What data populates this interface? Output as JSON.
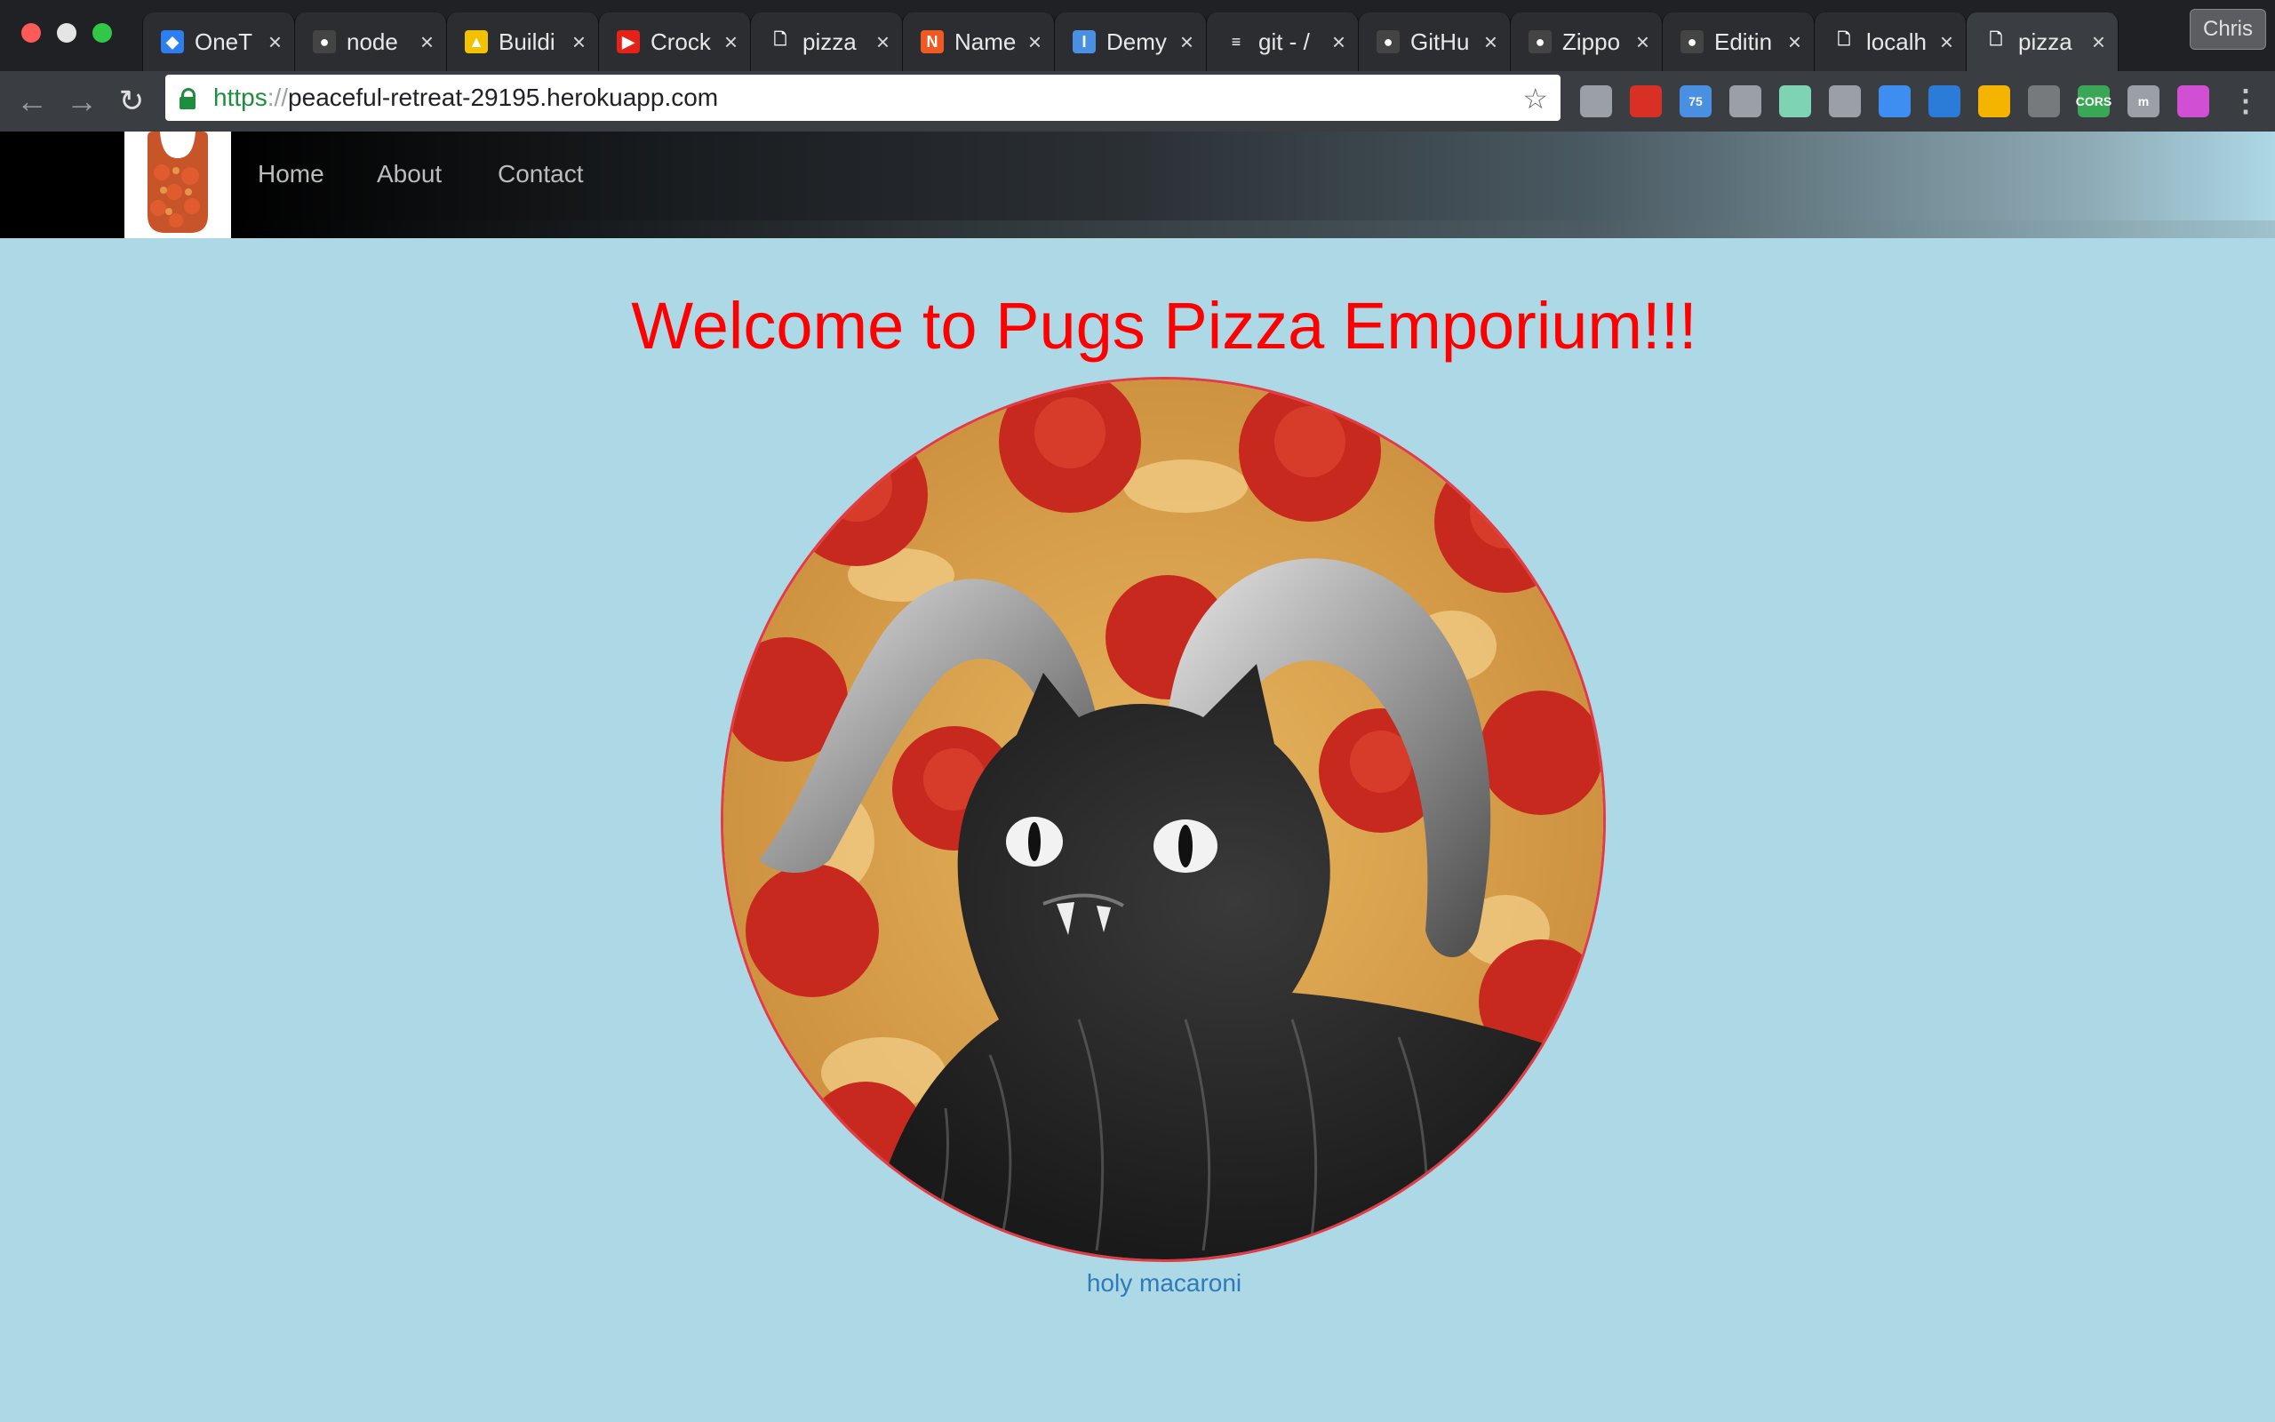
{
  "browser": {
    "tabs": [
      {
        "title": "OneT",
        "icon": "diamond-icon"
      },
      {
        "title": "node",
        "icon": "github-icon"
      },
      {
        "title": "Buildi",
        "icon": "hardhat-icon"
      },
      {
        "title": "Crock",
        "icon": "youtube-icon"
      },
      {
        "title": "pizza",
        "icon": "page-icon"
      },
      {
        "title": "Name",
        "icon": "namecheap-icon"
      },
      {
        "title": "Demy",
        "icon": "i-icon"
      },
      {
        "title": "git - /",
        "icon": "stackoverflow-icon"
      },
      {
        "title": "GitHu",
        "icon": "github-icon"
      },
      {
        "title": "Zippo",
        "icon": "github-icon"
      },
      {
        "title": "Editin",
        "icon": "github-icon"
      },
      {
        "title": "localh",
        "icon": "page-icon"
      },
      {
        "title": "pizza",
        "icon": "page-icon",
        "active": true
      }
    ],
    "profile": "Chris",
    "url": {
      "scheme": "https",
      "separator": "://",
      "host": "peaceful-retreat-29195.herokuapp.com"
    },
    "extensions": [
      {
        "name": "drive-icon",
        "color": "#9aa0a6"
      },
      {
        "name": "tool-icon",
        "color": "#d93025"
      },
      {
        "name": "weather-icon",
        "color": "#4a90e2",
        "label": "75"
      },
      {
        "name": "pumpkin-icon",
        "color": "#9aa0a6"
      },
      {
        "name": "waveform-icon",
        "color": "#7fd3b5"
      },
      {
        "name": "bulb-icon",
        "color": "#9aa0a6"
      },
      {
        "name": "diamond-icon",
        "color": "#3d8ef0"
      },
      {
        "name": "css-icon",
        "color": "#2b7bd8"
      },
      {
        "name": "palette-icon",
        "color": "#f4b400"
      },
      {
        "name": "angular-icon",
        "color": "#777a7d"
      },
      {
        "name": "cors-icon",
        "color": "#3aa757",
        "label": "CORS"
      },
      {
        "name": "m-icon",
        "color": "#9aa0a6",
        "label": "m"
      },
      {
        "name": "rainbow-icon",
        "color": "#d04fd2"
      }
    ]
  },
  "site": {
    "nav": [
      "Home",
      "About",
      "Contact"
    ],
    "heading": "Welcome to Pugs Pizza Emporium!!!",
    "caption": "holy macaroni",
    "colors": {
      "background": "#add8e6",
      "heading": "#ff0000",
      "caption": "#2f7ab8",
      "ring": "#e53945"
    }
  }
}
